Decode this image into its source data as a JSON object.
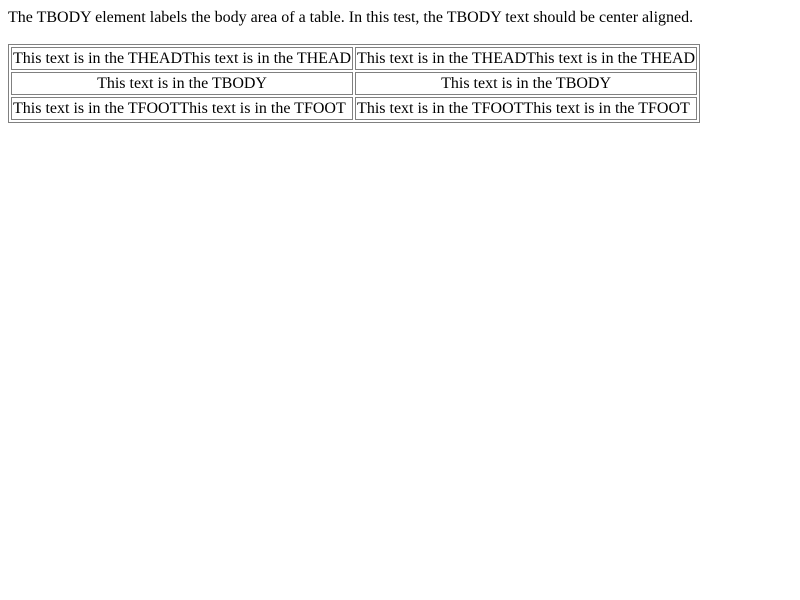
{
  "intro_text": "The TBODY element labels the body area of a table. In this test, the TBODY text should be center aligned.",
  "table": {
    "thead": {
      "cells": [
        "This text is in the THEADThis text is in the THEAD",
        "This text is in the THEADThis text is in the THEAD"
      ]
    },
    "tbody": {
      "cells": [
        "This text is in the TBODY",
        "This text is in the TBODY"
      ]
    },
    "tfoot": {
      "cells": [
        "This text is in the TFOOTThis text is in the TFOOT",
        "This text is in the TFOOTThis text is in the TFOOT"
      ]
    }
  },
  "colors": {
    "background": "#ffffff",
    "text": "#000000",
    "border": "#808080"
  }
}
